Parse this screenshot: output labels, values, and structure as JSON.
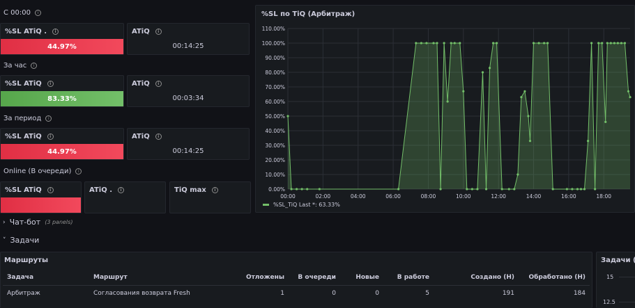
{
  "rows": {
    "since_midnight": "С 00:00",
    "per_hour": "За час",
    "per_period": "За период",
    "online": "Online (В очереди)"
  },
  "stats": {
    "s1": {
      "title": "%SL ATiQ .",
      "value": "44.97%",
      "fill": 1.0
    },
    "s1b": {
      "title": "ATiQ",
      "value": "00:14:25"
    },
    "s2": {
      "title": "%SL ATiQ",
      "value": "83.33%",
      "fill": 1.0
    },
    "s2b": {
      "title": "ATiQ",
      "value": "00:03:34"
    },
    "s3": {
      "title": "%SL ATiQ",
      "value": "44.97%",
      "fill": 1.0
    },
    "s3b": {
      "title": "ATiQ",
      "value": "00:14:25"
    },
    "s4": {
      "title": "%SL ATiQ",
      "fill": 1.0
    },
    "s4b": {
      "title": "ATiQ ."
    },
    "s4c": {
      "title": "TiQ max"
    }
  },
  "chart_panel": {
    "title": "%SL по TiQ (Арбитраж)",
    "legend": "%SL_TiQ  Last *: 63.33%"
  },
  "chart_data": {
    "type": "area",
    "title": "%SL по TiQ (Арбитраж)",
    "y_ticks": [
      "0.00%",
      "10.00%",
      "20.00%",
      "30.00%",
      "40.00%",
      "50.00%",
      "60.00%",
      "70.00%",
      "80.00%",
      "90.00%",
      "100.00%",
      "110.00%"
    ],
    "x_ticks": [
      "00:00",
      "02:00",
      "04:00",
      "06:00",
      "08:00",
      "10:00",
      "12:00",
      "14:00",
      "16:00",
      "18:00"
    ],
    "ylim": [
      0,
      110
    ],
    "xlim": [
      0,
      19.5
    ],
    "series": [
      {
        "name": "%SL_TiQ",
        "color": "#73bf69",
        "points": [
          [
            0.0,
            50
          ],
          [
            0.2,
            0
          ],
          [
            0.5,
            0
          ],
          [
            0.8,
            0
          ],
          [
            1.1,
            0
          ],
          [
            1.8,
            0
          ],
          [
            6.3,
            0
          ],
          [
            7.3,
            100
          ],
          [
            7.6,
            100
          ],
          [
            7.9,
            100
          ],
          [
            8.3,
            100
          ],
          [
            8.5,
            100
          ],
          [
            8.7,
            0
          ],
          [
            8.9,
            100
          ],
          [
            9.1,
            60
          ],
          [
            9.3,
            100
          ],
          [
            9.5,
            100
          ],
          [
            9.8,
            100
          ],
          [
            10.0,
            67
          ],
          [
            10.2,
            0
          ],
          [
            10.5,
            0
          ],
          [
            10.8,
            0
          ],
          [
            11.1,
            80
          ],
          [
            11.3,
            0
          ],
          [
            11.5,
            83
          ],
          [
            11.7,
            100
          ],
          [
            11.9,
            100
          ],
          [
            12.2,
            0
          ],
          [
            12.6,
            0
          ],
          [
            12.9,
            0
          ],
          [
            13.1,
            10
          ],
          [
            13.3,
            63
          ],
          [
            13.5,
            67
          ],
          [
            13.7,
            50
          ],
          [
            13.8,
            33
          ],
          [
            14.0,
            100
          ],
          [
            14.3,
            100
          ],
          [
            14.6,
            100
          ],
          [
            14.8,
            100
          ],
          [
            15.1,
            0
          ],
          [
            15.9,
            0
          ],
          [
            16.2,
            0
          ],
          [
            16.5,
            0
          ],
          [
            16.7,
            0
          ],
          [
            16.9,
            0
          ],
          [
            17.1,
            33
          ],
          [
            17.3,
            100
          ],
          [
            17.5,
            0
          ],
          [
            17.7,
            100
          ],
          [
            17.9,
            100
          ],
          [
            18.1,
            46
          ],
          [
            18.2,
            100
          ],
          [
            18.4,
            100
          ],
          [
            18.6,
            100
          ],
          [
            18.8,
            100
          ],
          [
            19.0,
            100
          ],
          [
            19.2,
            100
          ],
          [
            19.4,
            67
          ],
          [
            19.5,
            63
          ]
        ]
      }
    ]
  },
  "collapsed_row": {
    "title": "Чат-бот",
    "count": "(3 panels)"
  },
  "tasks_row": {
    "title": "Задачи"
  },
  "routes_panel": {
    "title": "Маршруты",
    "columns": [
      "Задача",
      "Маршрут",
      "Отложены",
      "В очереди",
      "Новые",
      "В работе",
      "Создано (Н)",
      "Обработано (Н)"
    ],
    "rows": [
      [
        "Арбитраж",
        "Согласования возврата Fresh",
        "1",
        "0",
        "0",
        "5",
        "191",
        "184"
      ]
    ]
  },
  "right_panel": {
    "title": "Задачи (Ар",
    "ticks": [
      "15",
      "12.5"
    ]
  }
}
